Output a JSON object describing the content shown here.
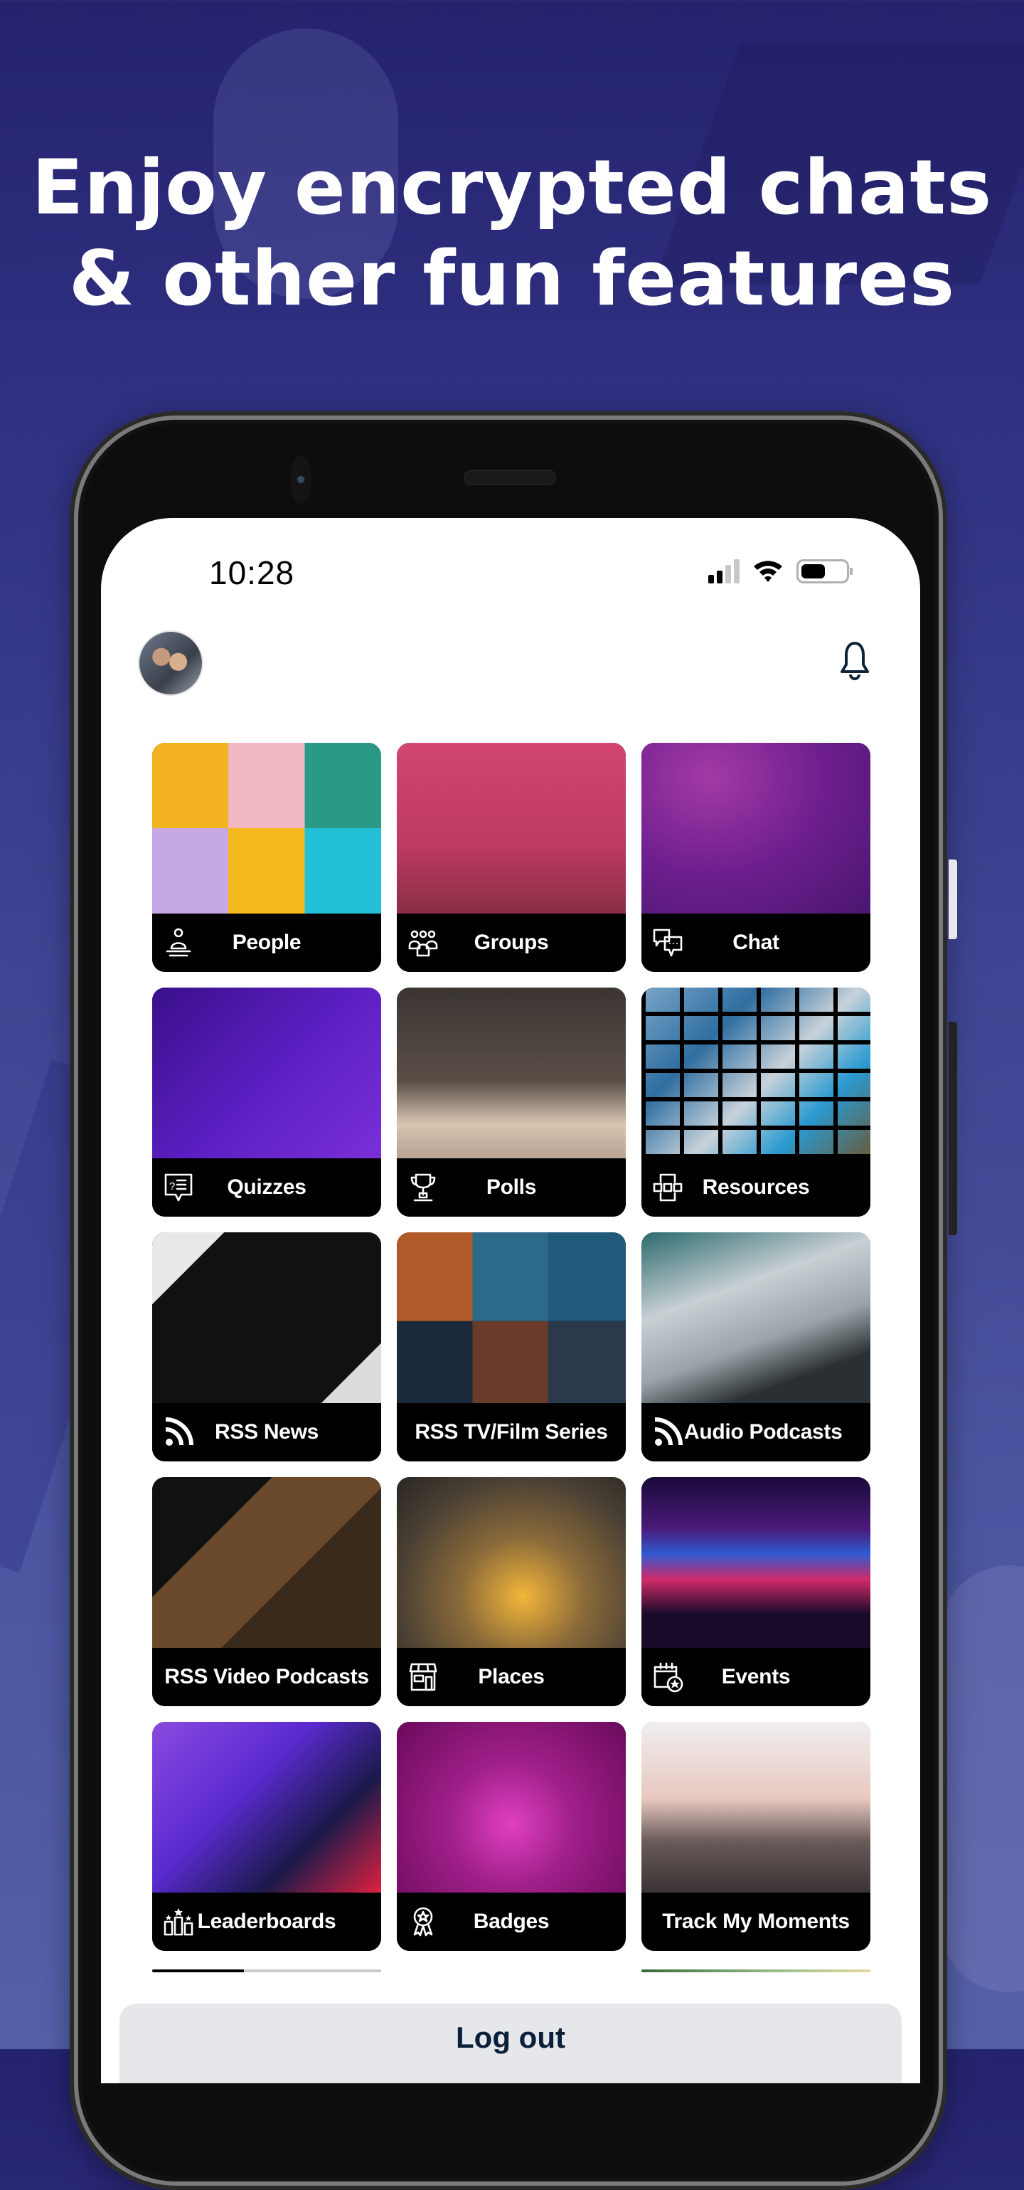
{
  "headline": {
    "line1": "Enjoy encrypted chats",
    "line2": "& other fun features"
  },
  "status_bar": {
    "time": "10:28",
    "signal_bars_active": 2,
    "signal_bars_total": 4,
    "battery_level_percent": 55
  },
  "header": {
    "avatar_icon": "user-avatar",
    "notifications_icon": "bell-icon"
  },
  "tiles": [
    {
      "label": "People",
      "icon": "person-podium-icon"
    },
    {
      "label": "Groups",
      "icon": "group-icon"
    },
    {
      "label": "Chat",
      "icon": "chat-bubbles-icon"
    },
    {
      "label": "Quizzes",
      "icon": "quiz-bubble-icon"
    },
    {
      "label": "Polls",
      "icon": "trophy-icon"
    },
    {
      "label": "Resources",
      "icon": "resources-icon"
    },
    {
      "label": "RSS News",
      "icon": "rss-icon"
    },
    {
      "label": "RSS TV/Film Series",
      "icon": null
    },
    {
      "label": "Audio Podcasts",
      "icon": "rss-icon"
    },
    {
      "label": "RSS Video Podcasts",
      "icon": null
    },
    {
      "label": "Places",
      "icon": "storefront-icon"
    },
    {
      "label": "Events",
      "icon": "calendar-star-icon"
    },
    {
      "label": "Leaderboards",
      "icon": "leaderboard-icon"
    },
    {
      "label": "Badges",
      "icon": "badge-ribbon-icon"
    },
    {
      "label": "Track My Moments",
      "icon": null
    }
  ],
  "logout": {
    "label": "Log out"
  }
}
